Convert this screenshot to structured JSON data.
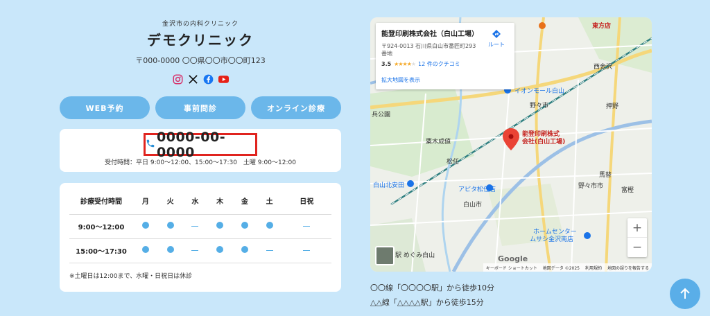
{
  "clinic": {
    "subtitle": "金沢市の内科クリニック",
    "name": "デモクリニック",
    "address": "〒000-0000 〇〇県〇〇市〇〇町123"
  },
  "social": [
    "instagram-icon",
    "x-icon",
    "facebook-icon",
    "youtube-icon"
  ],
  "buttons": {
    "web": "WEB予約",
    "pre": "事前問診",
    "online": "オンライン診療"
  },
  "phone": {
    "number": "0000-00-0000",
    "hours": "受付時間：平日 9:00〜12:00、15:00〜17:30　土曜 9:00〜12:00"
  },
  "schedule": {
    "header": [
      "診療受付時間",
      "月",
      "火",
      "水",
      "木",
      "金",
      "土",
      "日祝"
    ],
    "rows": [
      {
        "time": "9:00〜12:00",
        "marks": [
          "dot",
          "dot",
          "dash",
          "dot",
          "dot",
          "dot",
          "dash"
        ]
      },
      {
        "time": "15:00〜17:30",
        "marks": [
          "dot",
          "dot",
          "dash",
          "dot",
          "dot",
          "dash",
          "dash"
        ]
      }
    ],
    "note": "※土曜日は12:00まで、水曜・日祝日は休診"
  },
  "map": {
    "place_name": "能登印刷株式会社（白山工場）",
    "place_address": "〒924-0013 石川県白山市番匠町293番地",
    "rating": "3.5",
    "reviews": "12 件のクチコミ",
    "larger_map": "拡大地図を表示",
    "route": "ルート",
    "marker_label_1": "能登印刷株式",
    "marker_label_2": "会社(白山工場)",
    "labels": {
      "aeon": "イオンモール白山",
      "nonoichi": "野々市",
      "nonoichi_city": "野々市市",
      "matto": "松任",
      "hakusan_city": "白山市",
      "apita": "アピタ松任店",
      "homecenter_1": "ホームセンター",
      "homecenter_2": "ムサシ金沢南店",
      "kitayasuda": "白山北安田",
      "higashiryo": "東方店",
      "nishikanazawa": "西金沢",
      "oshino": "押野",
      "tomitsu": "富樫",
      "umasa": "馬替",
      "park": "兵公園",
      "station": "駅 めぐみ白山",
      "sokoku": "粟木成値"
    },
    "attribution": [
      "キーボード ショートカット",
      "地図データ ©2025",
      "利用規約",
      "地図の誤りを報告する"
    ],
    "google": "Google"
  },
  "access": {
    "line1": "〇〇線「〇〇〇〇駅」から徒歩10分",
    "line2": "△△線「△△△△駅」から徒歩15分"
  },
  "colors": {
    "page_bg": "#c9e7fa",
    "accent": "#6bb7ea",
    "highlight": "#e0241f"
  }
}
